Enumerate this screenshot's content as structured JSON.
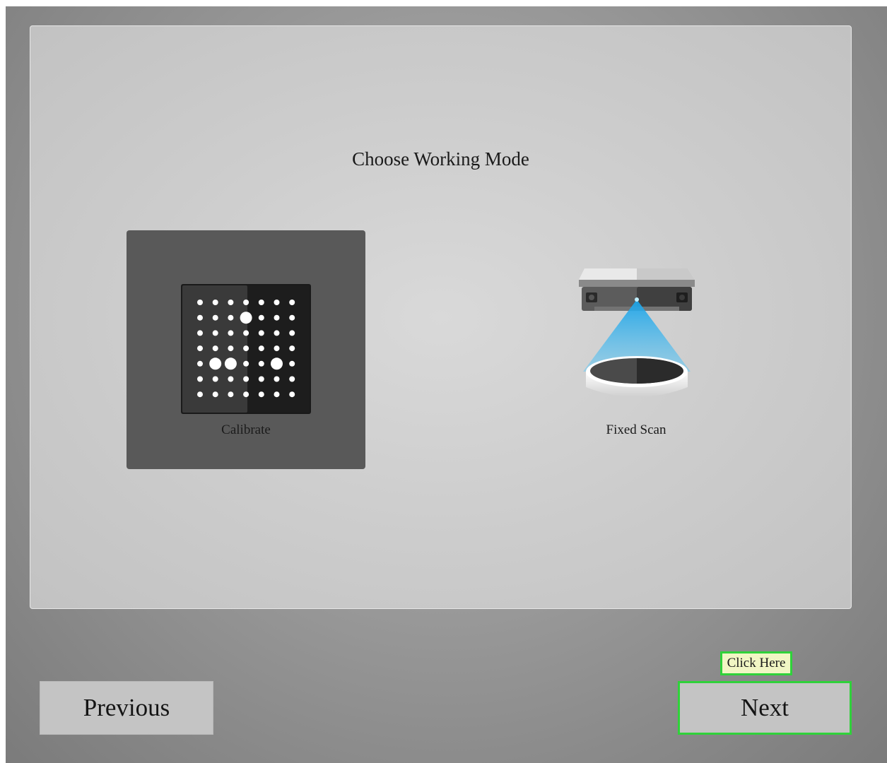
{
  "panel": {
    "title": "Choose Working Mode",
    "modes": [
      {
        "label": "Calibrate",
        "selected": true,
        "icon": "calibration-board-icon"
      },
      {
        "label": "Fixed Scan",
        "selected": false,
        "icon": "scanner-turntable-icon"
      }
    ]
  },
  "footer": {
    "previous_label": "Previous",
    "next_label": "Next",
    "hint_label": "Click Here"
  },
  "colors": {
    "selected_card": "#595959",
    "hint_border": "#2fd23a",
    "hint_background": "#f1f6c4",
    "scanner_beam": "#1aa3e8"
  }
}
